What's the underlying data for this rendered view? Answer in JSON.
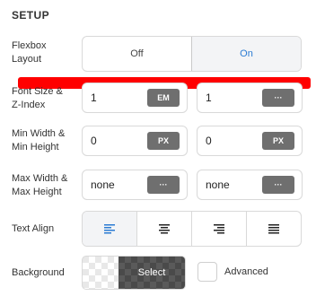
{
  "section_title": "SETUP",
  "flexbox": {
    "label_line1": "Flexbox",
    "label_line2": "Layout",
    "off": "Off",
    "on": "On",
    "selected": "On"
  },
  "font_size": {
    "label_line1": "Font Size &",
    "label_line2": "Z-Index",
    "value": "1",
    "unit": "EM",
    "zindex_value": "1",
    "zindex_unit": "···"
  },
  "min": {
    "label_line1": "Min Width &",
    "label_line2": "Min Height",
    "width_value": "0",
    "width_unit": "PX",
    "height_value": "0",
    "height_unit": "PX"
  },
  "max": {
    "label_line1": "Max Width &",
    "label_line2": "Max Height",
    "width_value": "none",
    "width_unit": "···",
    "height_value": "none",
    "height_unit": "···"
  },
  "text_align": {
    "label": "Text Align",
    "options": [
      "align-left-icon",
      "align-center-icon",
      "align-right-icon",
      "align-justify-icon"
    ],
    "selected": "align-left-icon"
  },
  "background": {
    "label": "Background",
    "select_label": "Select",
    "advanced_label": "Advanced",
    "advanced_checked": false
  },
  "colors": {
    "accent": "#2b7bd3",
    "unit_badge": "#6f6f6f",
    "annotation_bar": "#ff0000"
  }
}
